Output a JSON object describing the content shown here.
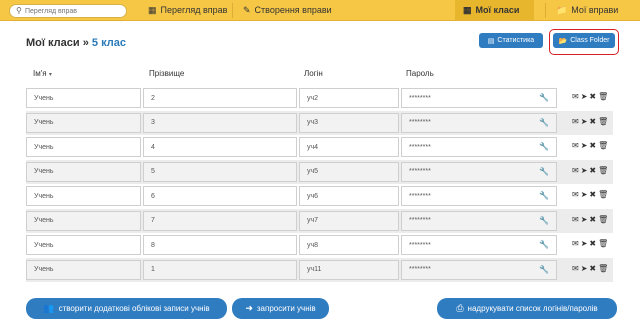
{
  "topbar": {
    "search_placeholder": "Перегляд вправ",
    "nav_browse": "Перегляд вправ",
    "nav_create": "Створення вправи",
    "nav_classes": "Мої класи",
    "nav_my_exercises": "Мої вправи"
  },
  "heading": {
    "title": "Мої класи",
    "separator": "»",
    "class_name": "5 клас"
  },
  "buttons": {
    "statistics": "Статистика",
    "class_folder": "Class Folder",
    "create_accounts": "створити додаткові облікові записи учнів",
    "invite": "запросити учнів",
    "print": "надрукувати список логінів/паролів"
  },
  "table": {
    "headers": {
      "name": "Ім'я",
      "sort_marker": "▾",
      "surname": "Прізвище",
      "login": "Логін",
      "password": "Пароль"
    },
    "rows": [
      {
        "name": "Учень",
        "surname": "2",
        "login": "уч2",
        "password": "********"
      },
      {
        "name": "Учень",
        "surname": "3",
        "login": "уч3",
        "password": "********"
      },
      {
        "name": "Учень",
        "surname": "4",
        "login": "уч4",
        "password": "********"
      },
      {
        "name": "Учень",
        "surname": "5",
        "login": "уч5",
        "password": "********"
      },
      {
        "name": "Учень",
        "surname": "6",
        "login": "уч6",
        "password": "********"
      },
      {
        "name": "Учень",
        "surname": "7",
        "login": "уч7",
        "password": "********"
      },
      {
        "name": "Учень",
        "surname": "8",
        "login": "уч8",
        "password": "********"
      },
      {
        "name": "Учень",
        "surname": "1",
        "login": "уч11",
        "password": "********"
      }
    ]
  },
  "icons": {
    "search": "search-icon",
    "grid": "grid-icon",
    "pencil": "pencil-icon",
    "grid_classes": "grid-icon",
    "folder": "folder-icon",
    "chart": "bar-chart-icon",
    "open_folder": "folder-open-icon",
    "wrench": "wrench-icon",
    "envelope": "envelope-icon",
    "send": "send-icon",
    "close": "close-icon",
    "trash": "trash-icon",
    "add_user": "add-user-icon",
    "login": "sign-in-icon",
    "print": "print-icon"
  },
  "colors": {
    "topbar": "#f6c745",
    "primary": "#2f7cc1",
    "accent_text": "#2a7ab8",
    "highlight_border": "#d92020"
  }
}
